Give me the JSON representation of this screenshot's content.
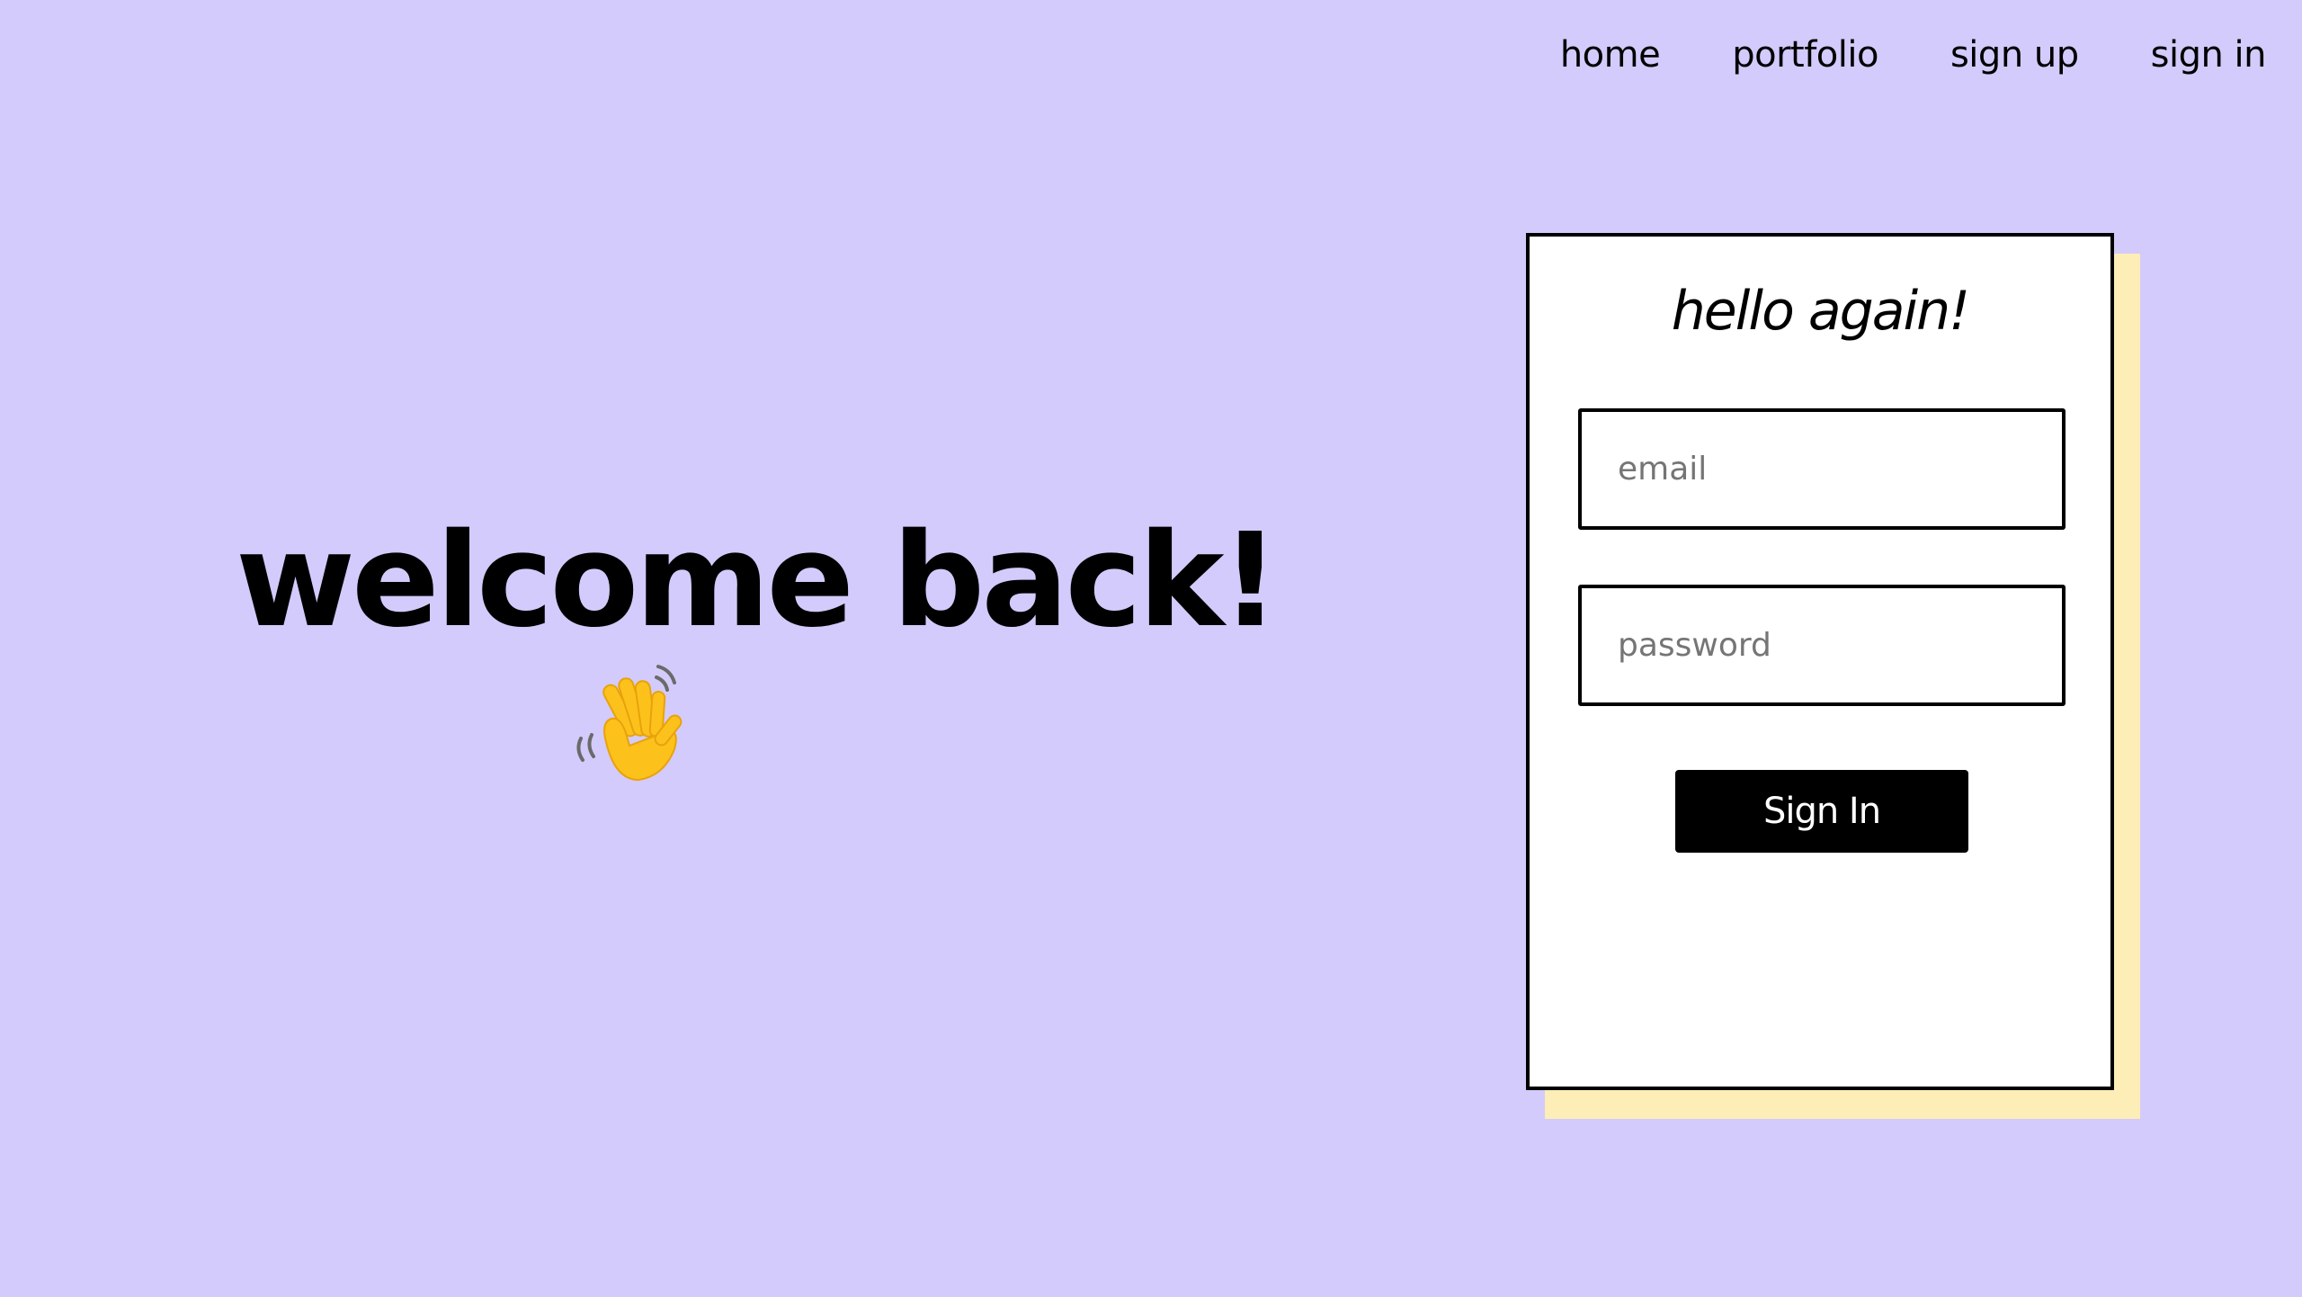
{
  "nav": {
    "items": [
      {
        "label": "home"
      },
      {
        "label": "portfolio"
      },
      {
        "label": "sign up"
      },
      {
        "label": "sign in"
      }
    ]
  },
  "hero": {
    "title": "welcome back!",
    "emoji_icon": "waving-hand-icon"
  },
  "card": {
    "title": "hello again!",
    "email": {
      "placeholder": "email",
      "value": ""
    },
    "password": {
      "placeholder": "password",
      "value": ""
    },
    "submit_label": "Sign In"
  },
  "colors": {
    "background": "#d3cbfb",
    "card_shadow": "#fdedb7",
    "button": "#000000",
    "card": "#ffffff"
  }
}
